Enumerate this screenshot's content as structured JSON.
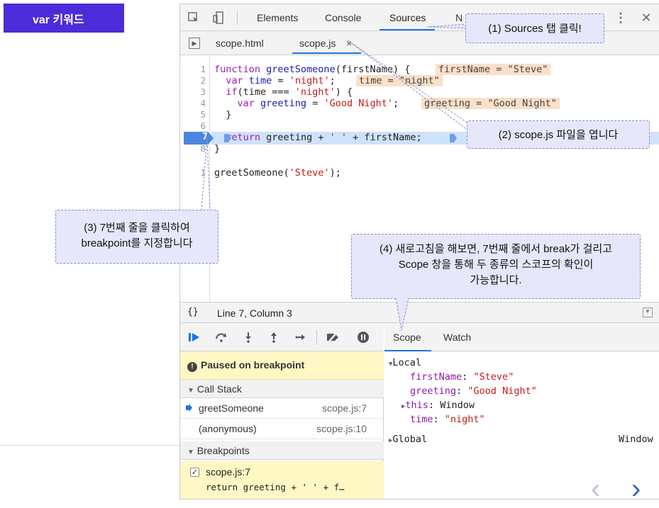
{
  "slide": {
    "title": "var 키워드"
  },
  "devtools": {
    "tabs": [
      "Elements",
      "Console",
      "Sources",
      "N"
    ],
    "files": [
      "scope.html",
      "scope.js",
      "×"
    ],
    "code": {
      "line_numbers": [
        "1",
        "2",
        "3",
        "4",
        "5",
        "6",
        "7",
        "8",
        "1"
      ],
      "lines": [
        {
          "a": "function ",
          "b": "greetSomeone",
          "c": "(firstName) {"
        },
        {
          "a": "  var ",
          "b": "time",
          "c": " = ",
          "d": "'night'",
          "e": ";"
        },
        {
          "a": "  if",
          "b": "(time === ",
          "c": "'night'",
          "d": ") {"
        },
        {
          "a": "    var ",
          "b": "greeting",
          "c": " = ",
          "d": "'Good Night'",
          "e": ";"
        },
        {
          "a": "  }"
        },
        {
          "a": ""
        },
        {
          "a": "  ",
          "b": "return",
          "c": " greeting + ",
          "d": "' '",
          "e": " + firstName;"
        },
        {
          "a": "}"
        },
        {
          "a": "greetSomeone(",
          "b": "'Steve'",
          "c": ");"
        }
      ],
      "inline_values": [
        "firstName = \"Steve\"",
        "time = \"night\"",
        "greeting = \"Good Night\""
      ]
    },
    "status": "Line 7, Column 3",
    "paused_text": "Paused on breakpoint",
    "call_stack": {
      "header": "Call Stack",
      "rows": [
        {
          "fn": "greetSomeone",
          "loc": "scope.js:7"
        },
        {
          "fn": "(anonymous)",
          "loc": "scope.js:10"
        }
      ]
    },
    "breakpoints": {
      "header": "Breakpoints",
      "file": "scope.js:7",
      "code": "return greeting + ' ' + f…"
    },
    "scope_tabs": [
      "Scope",
      "Watch"
    ],
    "scope": {
      "local_label": "Local",
      "vars": [
        {
          "name": "firstName",
          "value": "\"Steve\""
        },
        {
          "name": "greeting",
          "value": "\"Good Night\""
        },
        {
          "name": "this",
          "value": "Window"
        },
        {
          "name": "time",
          "value": "\"night\""
        }
      ],
      "global_label": "Global",
      "global_value": "Window"
    }
  },
  "callouts": {
    "c1": "(1) Sources 탭 클릭!",
    "c2": "(2) scope.js 파일을 엽니다",
    "c3_line1": "(3) 7번째 줄을 클릭하여",
    "c3_line2": "breakpoint를 지정합니다",
    "c4_line1": "(4) 새로고침을 해보면, 7번째 줄에서 break가 걸리고",
    "c4_line2": "Scope 창을 통해 두 종류의 스코프의 확인이",
    "c4_line3": "가능합니다."
  },
  "nav": {
    "prev": "‹",
    "next": "›"
  }
}
